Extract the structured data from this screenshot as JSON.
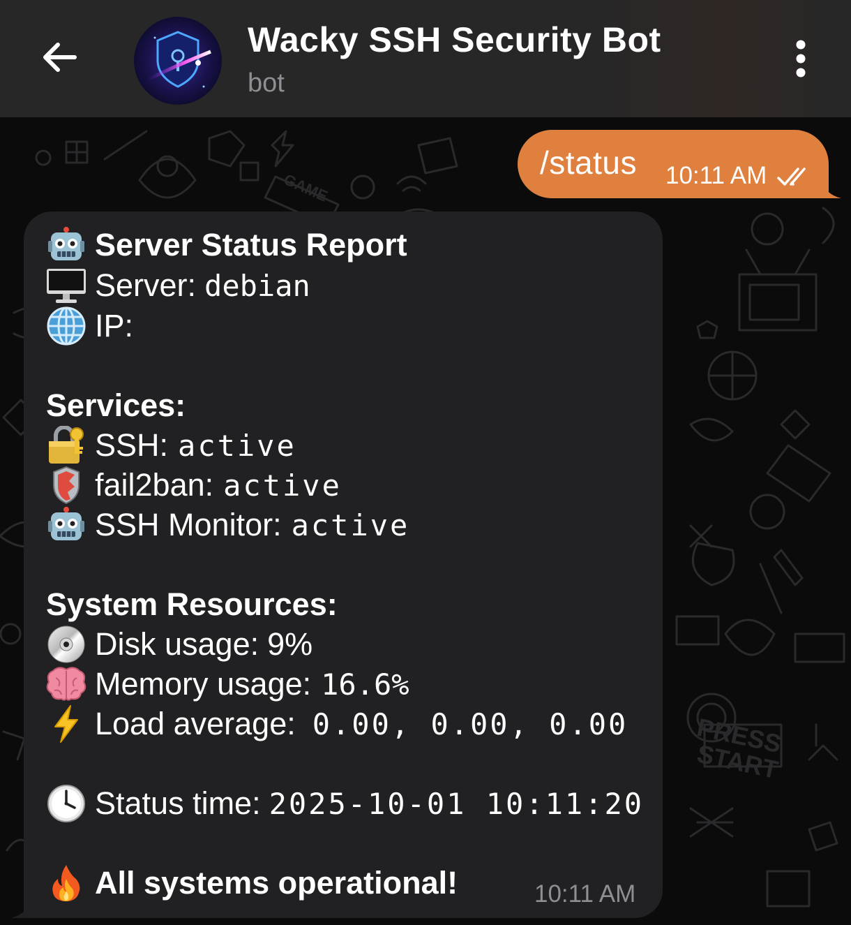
{
  "header": {
    "back_icon": "arrow-left-icon",
    "title": "Wacky SSH Security Bot",
    "subtitle": "bot",
    "more_icon": "more-vertical-icon"
  },
  "outgoing": {
    "text": "/status",
    "time": "10:11 AM",
    "status_icon": "double-check-icon",
    "color": "#e0803f"
  },
  "incoming": {
    "background": "#212123",
    "heading": {
      "emoji": "robot-icon",
      "text": "Server Status Report"
    },
    "server": {
      "emoji": "desktop-computer-icon",
      "label": "Server:",
      "value": "debian"
    },
    "ip": {
      "emoji": "globe-icon",
      "label": "IP:"
    },
    "services_title": "Services:",
    "services": [
      {
        "emoji": "lock-with-key-icon",
        "label": "SSH:",
        "value": "active"
      },
      {
        "emoji": "shield-icon",
        "label": "fail2ban:",
        "value": "active"
      },
      {
        "emoji": "robot-icon",
        "label": "SSH Monitor:",
        "value": "active"
      }
    ],
    "resources_title": "System Resources:",
    "resources": [
      {
        "emoji": "disc-icon",
        "label": "Disk usage:",
        "value": "9%"
      },
      {
        "emoji": "brain-icon",
        "label": "Memory usage:",
        "value": "16.6%"
      },
      {
        "emoji": "lightning-icon",
        "label": "Load average:",
        "value": "0.00, 0.00, 0.00"
      }
    ],
    "status_time": {
      "emoji": "clock-icon",
      "label": "Status time:",
      "value": "2025-10-01 10:11:20"
    },
    "footer": {
      "emoji": "fire-icon",
      "text": "All systems operational!"
    },
    "time": "10:11 AM"
  }
}
